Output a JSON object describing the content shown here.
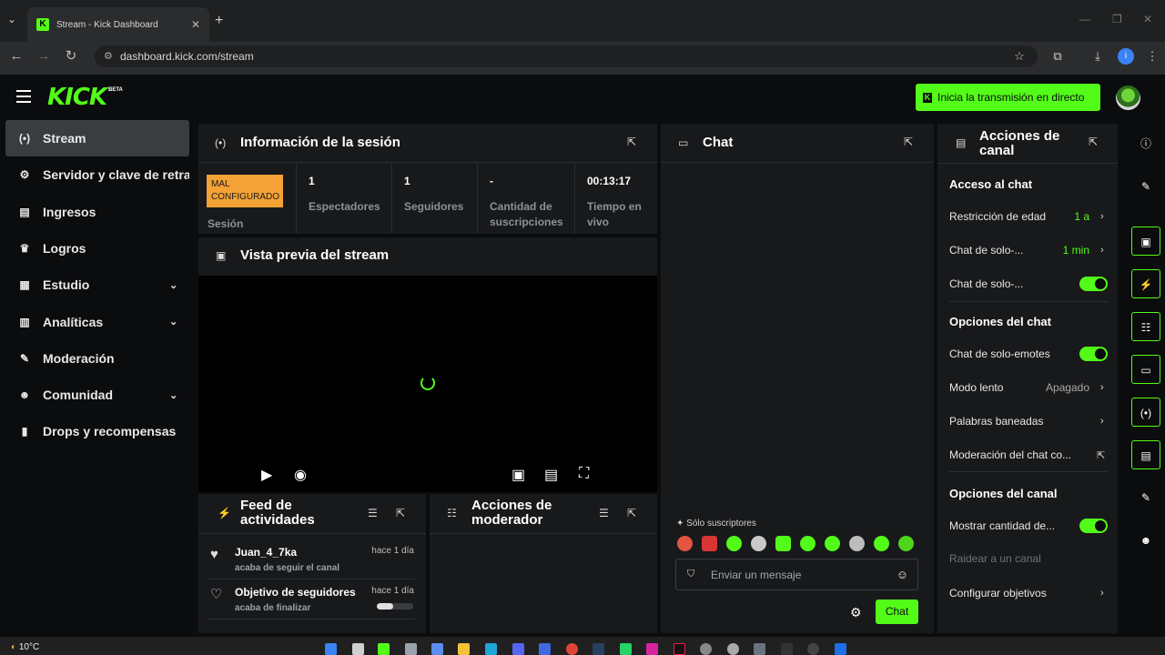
{
  "browser": {
    "tab_title": "Stream - Kick Dashboard",
    "tab_close": "✕",
    "new_tab": "+",
    "url": "dashboard.kick.com/stream",
    "profile_initial": "i"
  },
  "header": {
    "logo": "KICK",
    "logo_badge": "BETA",
    "go_live_label": "Inicia la transmisión en directo",
    "go_live_icon": "K"
  },
  "sidebar": {
    "items": [
      {
        "label": "Stream",
        "icon": "broadcast-icon",
        "glyph": "(•)"
      },
      {
        "label": "Servidor y clave de retransmisión",
        "icon": "key-icon",
        "glyph": "⚙"
      },
      {
        "label": "Ingresos",
        "icon": "revenue-icon",
        "glyph": "▤"
      },
      {
        "label": "Logros",
        "icon": "trophy-icon",
        "glyph": "♛"
      },
      {
        "label": "Estudio",
        "icon": "studio-icon",
        "glyph": "▦",
        "chevron": "⌄"
      },
      {
        "label": "Analíticas",
        "icon": "analytics-icon",
        "glyph": "▥",
        "chevron": "⌄"
      },
      {
        "label": "Moderación",
        "icon": "wrench-icon",
        "glyph": "✎"
      },
      {
        "label": "Comunidad",
        "icon": "community-icon",
        "glyph": "☻",
        "chevron": "⌄"
      },
      {
        "label": "Drops y recompensas",
        "icon": "drops-icon",
        "glyph": "▮"
      }
    ]
  },
  "session": {
    "title": "Información de la sesión",
    "status_badge": "MAL CONFIGURADO",
    "status_label": "Sesión",
    "stats": [
      {
        "value": "1",
        "label": "Espectadores"
      },
      {
        "value": "1",
        "label": "Seguidores"
      },
      {
        "value": "-",
        "label": "Cantidad de suscripciones"
      },
      {
        "value": "00:13:17",
        "label": "Tiempo en vivo"
      }
    ]
  },
  "preview": {
    "title": "Vista previa del stream"
  },
  "feed": {
    "title": "Feed de actividades",
    "items": [
      {
        "name": "Juan_4_7ka",
        "sub": "acaba de seguir el canal",
        "time": "hace 1 día"
      },
      {
        "name": "Objetivo de seguidores",
        "sub": "acaba de finalizar",
        "time": "hace 1 día",
        "progress": 0.45
      }
    ]
  },
  "moderator": {
    "title": "Acciones de moderador"
  },
  "chat": {
    "title": "Chat",
    "subscribers_only": "Sólo suscriptores",
    "input_placeholder": "Enviar un mensaje",
    "send_label": "Chat"
  },
  "actions": {
    "title": "Acciones de canal",
    "sections": {
      "chat_access": "Acceso al chat",
      "chat_options": "Opciones del chat",
      "channel_options": "Opciones del canal"
    },
    "rows": {
      "age_restriction": {
        "label": "Restricción de edad",
        "value": "1 a"
      },
      "followers_only": {
        "label": "Chat de solo-...",
        "value": "1 min"
      },
      "subs_only": {
        "label": "Chat de solo-...",
        "enabled": true
      },
      "emotes_only": {
        "label": "Chat de solo-emotes",
        "enabled": true
      },
      "slow_mode": {
        "label": "Modo lento",
        "value": "Apagado"
      },
      "banned_words": {
        "label": "Palabras baneadas"
      },
      "chat_moderation": {
        "label": "Moderación del chat co..."
      },
      "show_count": {
        "label": "Mostrar cantidad de...",
        "enabled": true
      },
      "raid": {
        "label": "Raidear a un canal"
      },
      "goals": {
        "label": "Configurar objetivos"
      }
    }
  },
  "taskbar": {
    "weather": "10°C"
  },
  "colors": {
    "accent": "#53fc18",
    "badge": "#f4a236",
    "panel": "#18191b",
    "background": "#0b0c0d"
  }
}
